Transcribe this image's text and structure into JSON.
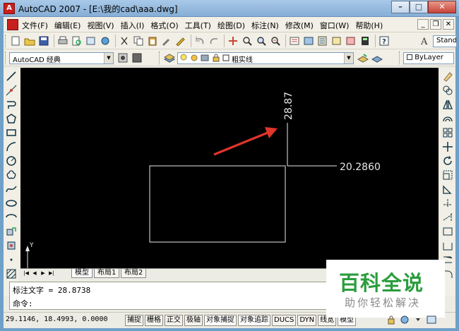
{
  "window": {
    "title": "AutoCAD 2007 - [E:\\我的cad\\aaa.dwg]",
    "minimize_glyph": "–",
    "restore_glyph": "□",
    "close_glyph": "✕"
  },
  "menu": {
    "items": [
      "文件(F)",
      "编辑(E)",
      "视图(V)",
      "插入(I)",
      "格式(O)",
      "工具(T)",
      "绘图(D)",
      "标注(N)",
      "修改(M)",
      "窗口(W)",
      "帮助(H)"
    ],
    "doc_controls": [
      "_",
      "❐",
      "✕"
    ]
  },
  "toolbars": {
    "text_style": "Standa",
    "workspace": "AutoCAD 经典",
    "layer": "粗实线",
    "color": "ByLayer"
  },
  "drawing": {
    "dimension_vertical": "28.87",
    "dimension_horizontal": "20.2860",
    "ucs_x": "X",
    "ucs_y": "Y",
    "arrow_color": "#e0352b"
  },
  "tabs": {
    "nav": [
      "|◀",
      "◀",
      "▶",
      "▶|"
    ],
    "items": [
      "模型",
      "布局1",
      "布局2"
    ],
    "active": "模型"
  },
  "command": {
    "line1": "标注文字 = 28.8738",
    "line2": "命令:"
  },
  "status": {
    "coords": "29.1146, 18.4993, 0.0000",
    "buttons": [
      "捕捉",
      "栅格",
      "正交",
      "极轴",
      "对象捕捉",
      "对象追踪",
      "DUCS",
      "DYN",
      "线宽",
      "模型"
    ]
  },
  "watermark": {
    "title": "百科全说",
    "subtitle": "助你轻松解决"
  }
}
